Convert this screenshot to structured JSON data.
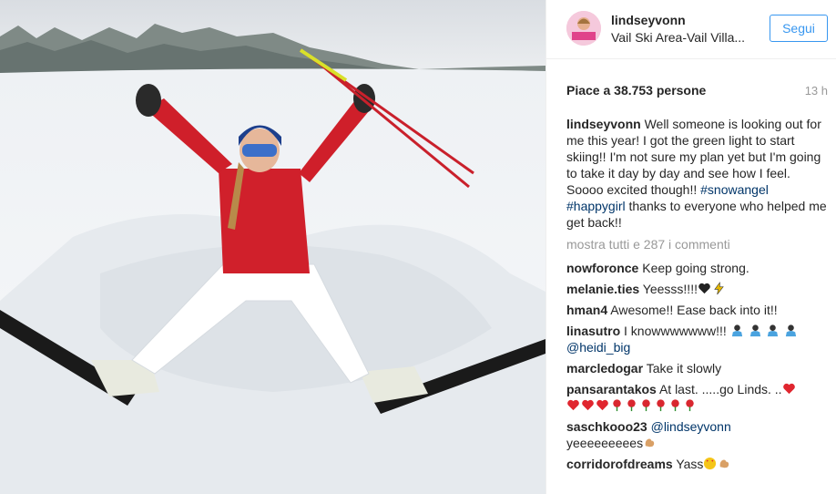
{
  "post": {
    "username": "lindseyvonn",
    "location": "Vail Ski Area-Vail Villa...",
    "follow_label": "Segui",
    "likes": "Piace a 38.753 persone",
    "time": "13 h",
    "caption": {
      "username": "lindseyvonn",
      "text": "Well someone is looking out for me this year! I got the green light to start skiing!! I'm not sure my plan yet but I'm going to take it day by day and see how I feel. Soooo excited though!!",
      "hashtags": [
        "#snowangel",
        "#happygirl"
      ],
      "after": "thanks to everyone who helped me get back!!"
    },
    "view_all": "mostra tutti e 287 i commenti",
    "comments": [
      {
        "username": "nowforonce",
        "text": "Keep going strong."
      },
      {
        "username": "melanie.ties",
        "text": "Yeesss!!!!",
        "emoji": [
          "black-heart-icon",
          "lightning-icon"
        ]
      },
      {
        "username": "hman4",
        "text": "Awesome!! Ease back into it!!"
      },
      {
        "username": "linasutro",
        "text": "I knowwwwwww!!!",
        "emoji": [
          "skier-icon",
          "skier-icon",
          "skier-icon",
          "skier-icon"
        ],
        "mention": "@heidi_big"
      },
      {
        "username": "marcledogar",
        "text": "Take it slowly"
      },
      {
        "username": "pansarantakos",
        "text": "At last. .....go Linds. ..",
        "emoji": [
          "red-heart-icon",
          "red-heart-icon",
          "red-heart-icon",
          "red-heart-icon",
          "rose-icon",
          "rose-icon",
          "rose-icon",
          "rose-icon",
          "rose-icon",
          "rose-icon"
        ]
      },
      {
        "username": "saschkooo23",
        "mention": "@lindseyvonn",
        "text": "yeeeeeeeees",
        "emoji": [
          "muscle-icon"
        ]
      },
      {
        "username": "corridorofdreams",
        "text": "Yass",
        "emoji": [
          "heart-eyes-icon",
          "muscle-icon"
        ]
      }
    ]
  }
}
